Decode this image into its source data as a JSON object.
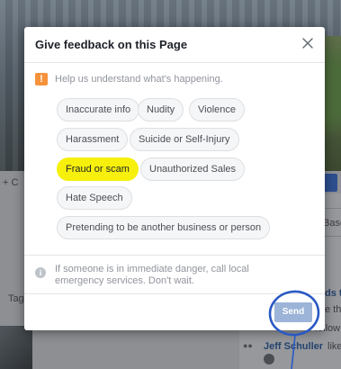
{
  "background": {
    "left_fragment": "+ C",
    "tag_fragment": "Tag",
    "right_panel": {
      "basic_fragment": "Base",
      "ads_fragment": "ds to",
      "e_this_fragment": "e thi",
      "follow_fragment": "follow",
      "activity": {
        "name": "Jeff Schuller",
        "action": "likes thi"
      }
    }
  },
  "dialog": {
    "title": "Give feedback on this Page",
    "close_glyph": "×",
    "info_icon_glyph": "!",
    "info_text": "Help us understand what's happening.",
    "options": [
      {
        "label": "Inaccurate info",
        "selected": false
      },
      {
        "label": "Nudity",
        "selected": false
      },
      {
        "label": "Violence",
        "selected": false
      },
      {
        "label": "Harassment",
        "selected": false
      },
      {
        "label": "Suicide or Self-Injury",
        "selected": false
      },
      {
        "label": "Fraud or scam",
        "selected": true
      },
      {
        "label": "Unauthorized Sales",
        "selected": false
      },
      {
        "label": "Hate Speech",
        "selected": false
      },
      {
        "label": "Pretending to be another business or person",
        "selected": false
      }
    ],
    "emergency_icon_glyph": "i",
    "emergency_text": "If someone is in immediate danger, call local emergency services. Don't wait.",
    "send_label": "Send"
  },
  "colors": {
    "highlight": "#f6f00c",
    "annotation": "#2a59c4",
    "warning": "#f7923b",
    "send_disabled": "#9cb4d8"
  }
}
